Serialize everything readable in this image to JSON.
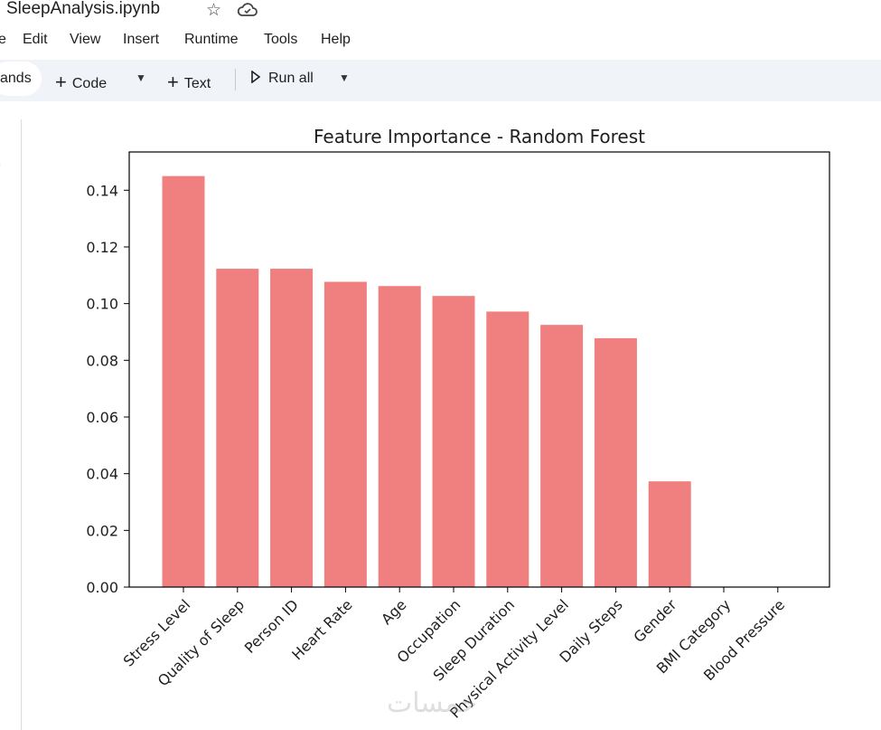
{
  "header": {
    "title": "SleepAnalysis.ipynb"
  },
  "menu": [
    "e",
    "Edit",
    "View",
    "Insert",
    "Runtime",
    "Tools",
    "Help"
  ],
  "toolbar": {
    "commands_label": "ands",
    "code_label": "Code",
    "text_label": "Text",
    "run_all_label": "Run all"
  },
  "watermark": "خمسات",
  "colors": {
    "bar": "#f08080",
    "toolbar_bg": "#f0f4f9"
  },
  "chart_data": {
    "type": "bar",
    "title": "Feature Importance - Random Forest",
    "xlabel": "",
    "ylabel": "",
    "categories": [
      "Stress Level",
      "Quality of Sleep",
      "Person ID",
      "Heart Rate",
      "Age",
      "Occupation",
      "Sleep Duration",
      "Physical Activity Level",
      "Daily Steps",
      "Gender",
      "BMI Category",
      "Blood Pressure"
    ],
    "values": [
      0.145,
      0.1123,
      0.1123,
      0.1077,
      0.1062,
      0.1027,
      0.0972,
      0.0925,
      0.0878,
      0.0373,
      0.0,
      0.0
    ],
    "ylim": [
      0,
      0.1535
    ],
    "yticks": [
      0.0,
      0.02,
      0.04,
      0.06,
      0.08,
      0.1,
      0.12,
      0.14
    ],
    "ytick_labels": [
      "0.00",
      "0.02",
      "0.04",
      "0.06",
      "0.08",
      "0.10",
      "0.12",
      "0.14"
    ],
    "grid": false
  }
}
